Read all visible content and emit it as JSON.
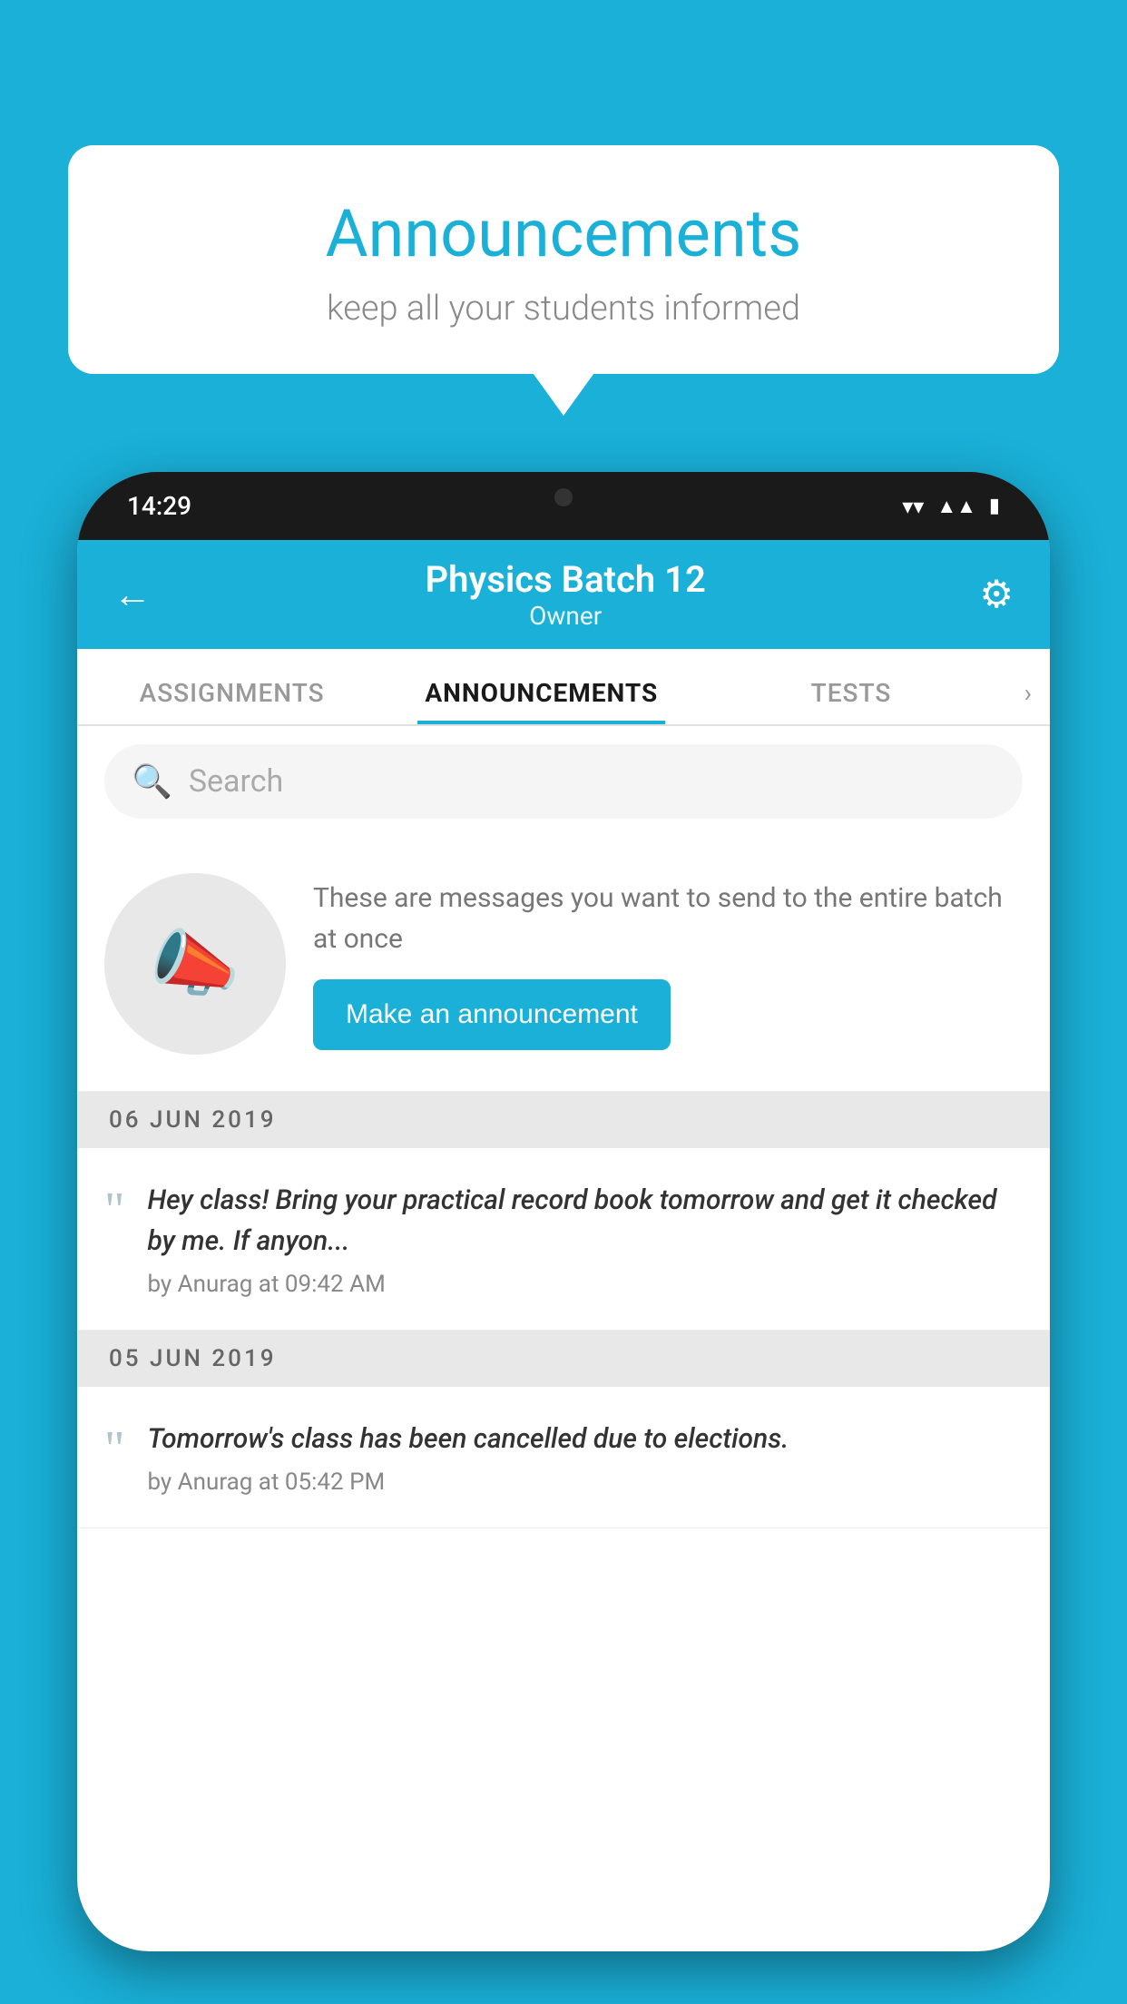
{
  "background_color": "#1ab0d8",
  "speech_bubble": {
    "title": "Announcements",
    "subtitle": "keep all your students informed"
  },
  "phone": {
    "status_bar": {
      "time": "14:29",
      "icons": [
        "wifi",
        "signal",
        "battery"
      ]
    },
    "header": {
      "title": "Physics Batch 12",
      "subtitle": "Owner",
      "back_label": "←",
      "settings_label": "⚙"
    },
    "tabs": [
      {
        "label": "ASSIGNMENTS",
        "active": false
      },
      {
        "label": "ANNOUNCEMENTS",
        "active": true
      },
      {
        "label": "TESTS",
        "active": false
      }
    ],
    "search": {
      "placeholder": "Search"
    },
    "promo": {
      "description": "These are messages you want to send to the entire batch at once",
      "button_label": "Make an announcement"
    },
    "announcements": [
      {
        "date": "06  JUN  2019",
        "text": "Hey class! Bring your practical record book tomorrow and get it checked by me. If anyon...",
        "meta": "by Anurag at 09:42 AM"
      },
      {
        "date": "05  JUN  2019",
        "text": "Tomorrow's class has been cancelled due to elections.",
        "meta": "by Anurag at 05:42 PM"
      }
    ]
  }
}
